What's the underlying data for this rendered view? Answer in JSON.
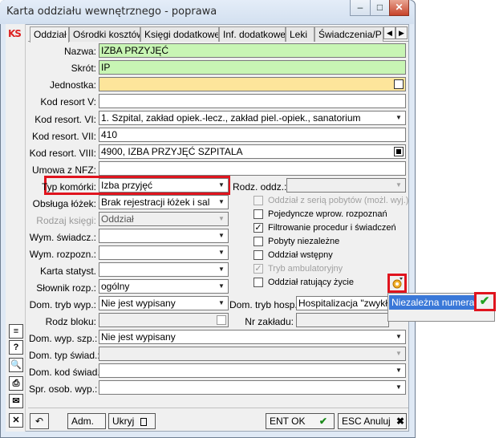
{
  "window": {
    "title": "Karta oddziału wewnętrznego - poprawa",
    "minimize": "–",
    "maximize": "□",
    "close": "✕"
  },
  "logo": "KS",
  "tabs": [
    "Oddział",
    "Ośrodki kosztów",
    "Księgi dodatkowe",
    "Inf. dodatkowe",
    "Leki",
    "Świadczenia/P"
  ],
  "form": {
    "nazwa": {
      "label": "Nazwa:",
      "value": "IZBA PRZYJĘĆ"
    },
    "skrot": {
      "label": "Skrót:",
      "value": "IP"
    },
    "jednostka": {
      "label": "Jednostka:",
      "value": ""
    },
    "kod_resort_v": {
      "label": "Kod resort V:",
      "value": ""
    },
    "kod_resort_vi": {
      "label": "Kod resort. VI:",
      "value": "1. Szpital, zakład opiek.-lecz., zakład piel.-opiek., sanatorium"
    },
    "kod_resort_vii": {
      "label": "Kod resort. VII:",
      "value": "410"
    },
    "kod_resort_viii": {
      "label": "Kod resort. VIII:",
      "value": "4900, IZBA PRZYJĘĆ SZPITALA"
    },
    "umowa_nfz": {
      "label": "Umowa z NFZ:",
      "value": ""
    },
    "typ_komorki": {
      "label": "Typ komórki:",
      "value": "Izba przyjęć"
    },
    "obsluga_lozek": {
      "label": "Obsługa łóżek:",
      "value": "Brak rejestracji łóżek i sal"
    },
    "rodzaj_ksiegi": {
      "label": "Rodzaj księgi:",
      "value": "Oddział"
    },
    "wym_swiadcz": {
      "label": "Wym. świadcz.:",
      "value": ""
    },
    "wym_rozpozn": {
      "label": "Wym. rozpozn.:",
      "value": ""
    },
    "karta_statyst": {
      "label": "Karta statyst.",
      "value": ""
    },
    "slownik_rozp": {
      "label": "Słownik rozp.:",
      "value": "ogólny"
    },
    "dom_tryb_wyp": {
      "label": "Dom. tryb wyp.:",
      "value": "Nie jest wypisany"
    },
    "rodz_bloku": {
      "label": "Rodz bloku:",
      "value": ""
    },
    "dom_wyp_szp": {
      "label": "Dom. wyp. szp.:",
      "value": "Nie jest wypisany"
    },
    "dom_typ_swiad": {
      "label": "Dom. typ świad.:",
      "value": ""
    },
    "dom_kod_swiad": {
      "label": "Dom. kod świad.:",
      "value": ""
    },
    "spr_osob_wyp": {
      "label": "Spr. osob. wyp.:",
      "value": ""
    },
    "rodz_oddz": {
      "label": "Rodz. oddz.:",
      "value": ""
    },
    "dom_tryb_hosp": {
      "label": "Dom. tryb hosp.:",
      "value": "Hospitalizacja \"zwykła\""
    },
    "nr_zakladu": {
      "label": "Nr zakładu:",
      "value": ""
    }
  },
  "checkboxes": [
    {
      "label": "Oddział z serią pobytów (możl. wyj.)",
      "checked": false,
      "disabled": true
    },
    {
      "label": "Pojedyncze wprow. rozpoznań",
      "checked": false,
      "disabled": false
    },
    {
      "label": "Filtrowanie procedur i świadczeń",
      "checked": true,
      "disabled": false
    },
    {
      "label": "Pobyty niezależne",
      "checked": false,
      "disabled": false
    },
    {
      "label": "Oddział wstępny",
      "checked": false,
      "disabled": false
    },
    {
      "label": "Tryb ambulatoryjny",
      "checked": true,
      "disabled": true
    },
    {
      "label": "Oddział ratujący życie",
      "checked": false,
      "disabled": false
    }
  ],
  "popup": {
    "item": "Niezależna numeracja"
  },
  "bottom": {
    "adm": "Adm.",
    "ukryj": "Ukryj",
    "ok": "ENT OK",
    "cancel": "ESC Anuluj"
  }
}
